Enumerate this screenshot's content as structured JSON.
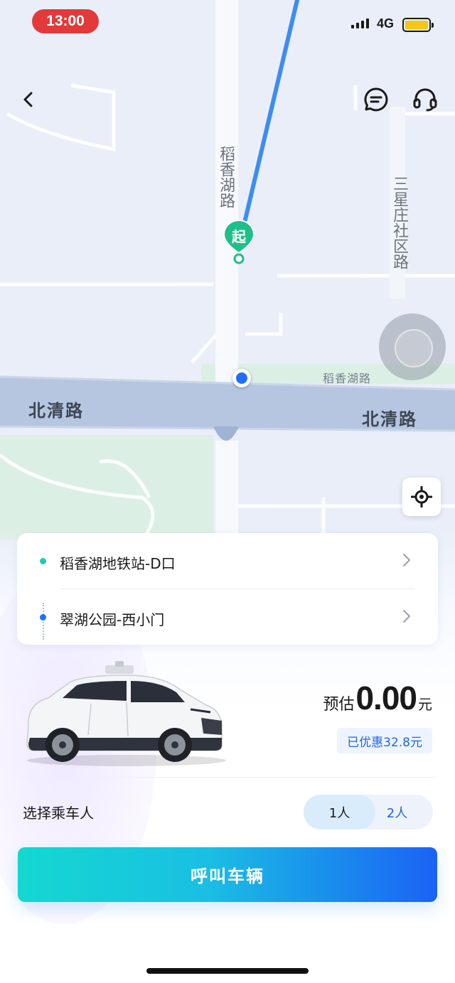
{
  "status_bar": {
    "time": "13:00",
    "network": "4G",
    "battery_level": 1.0,
    "battery_color": "#f5c518",
    "time_pill_color": "#e23a3a"
  },
  "header": {
    "back_icon": "chevron-left-icon",
    "message_icon": "chat-bubble-icon",
    "support_icon": "headset-icon"
  },
  "map": {
    "roads": {
      "daoxianghu_vertical": "稻香湖路",
      "sanxingzhuang": "三星庄社区路",
      "beiqing_left": "北清路",
      "beiqing_right": "北清路",
      "daoxianghu_small": "稻香湖路"
    },
    "start_pin_label": "起",
    "start_pin_color": "#1fbf8a",
    "route_color": "#3d8cf0",
    "locate_icon": "crosshair-icon"
  },
  "route": {
    "pickup": {
      "label": "稻香湖地铁站-D口",
      "dot_color": "#23c8b4"
    },
    "destination": {
      "label": "翠湖公园-西小门",
      "dot_color": "#1f6fff"
    }
  },
  "fare": {
    "prefix": "预估",
    "value": "0.00",
    "unit": "元",
    "discount": "已优惠32.8元"
  },
  "passengers": {
    "label": "选择乘车人",
    "options": [
      "1人",
      "2人"
    ],
    "selected": "1人"
  },
  "call_button": {
    "label": "呼叫车辆",
    "gradient_start": "#14d8d0",
    "gradient_end": "#1b62f5"
  }
}
